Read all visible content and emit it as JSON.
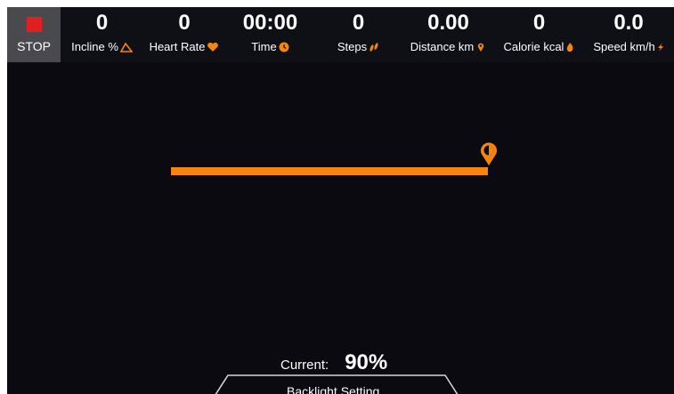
{
  "stop": {
    "label": "STOP"
  },
  "metrics": [
    {
      "value": "0",
      "label": "Incline %",
      "icon": "incline-icon"
    },
    {
      "value": "0",
      "label": "Heart Rate",
      "icon": "heart-icon"
    },
    {
      "value": "00:00",
      "label": "Time",
      "icon": "clock-icon"
    },
    {
      "value": "0",
      "label": "Steps",
      "icon": "footsteps-icon"
    },
    {
      "value": "0.00",
      "label": "Distance km",
      "icon": "location-pin-icon"
    },
    {
      "value": "0",
      "label": "Calorie kcal",
      "icon": "flame-icon"
    },
    {
      "value": "0.0",
      "label": "Speed km/h",
      "icon": "speed-icon"
    }
  ],
  "backlight": {
    "current_label": "Current:",
    "current_value": "90%",
    "level": 0.9,
    "setting_label": "Backlight Setting"
  },
  "colors": {
    "accent": "#f5850f",
    "stop": "#e02020",
    "background": "#0a0a10"
  }
}
